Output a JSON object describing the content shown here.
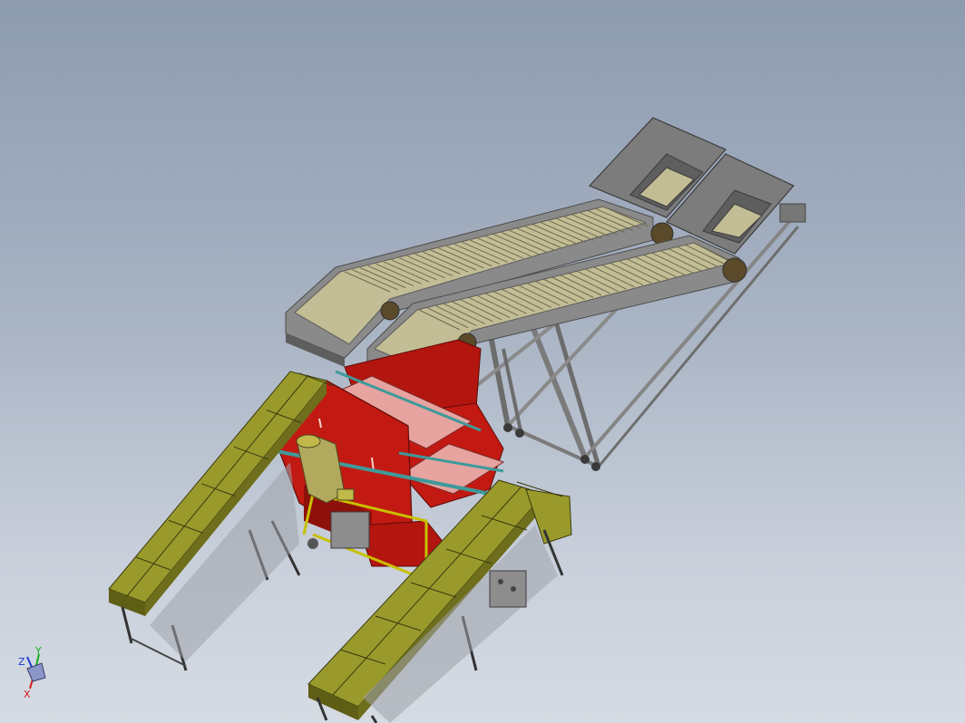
{
  "viewport": {
    "background_top": "#8d9bb0",
    "background_bottom": "#d6dbe3"
  },
  "colors": {
    "red_frame": "#c21a12",
    "red_dark": "#8e100b",
    "pink_panel": "#e7a3a0",
    "olive_conveyor": "#9a9a2c",
    "olive_dark": "#6e6e1c",
    "olive_body": "#b1aa5e",
    "grey_frame": "#8d8d8d",
    "grey_dark": "#5d5d5d",
    "teal_rail": "#3e9a9a",
    "beige_belt": "#c3bd95",
    "hopper_grey": "#7c7c7c",
    "yellow_sensor": "#c1b94a"
  },
  "triad": {
    "x_label": "X",
    "y_label": "Y",
    "z_label": "Z",
    "x_color": "#d51a1a",
    "y_color": "#16b01a",
    "z_color": "#1a3ad5"
  },
  "model": {
    "icon": "3d-assembly-model"
  }
}
